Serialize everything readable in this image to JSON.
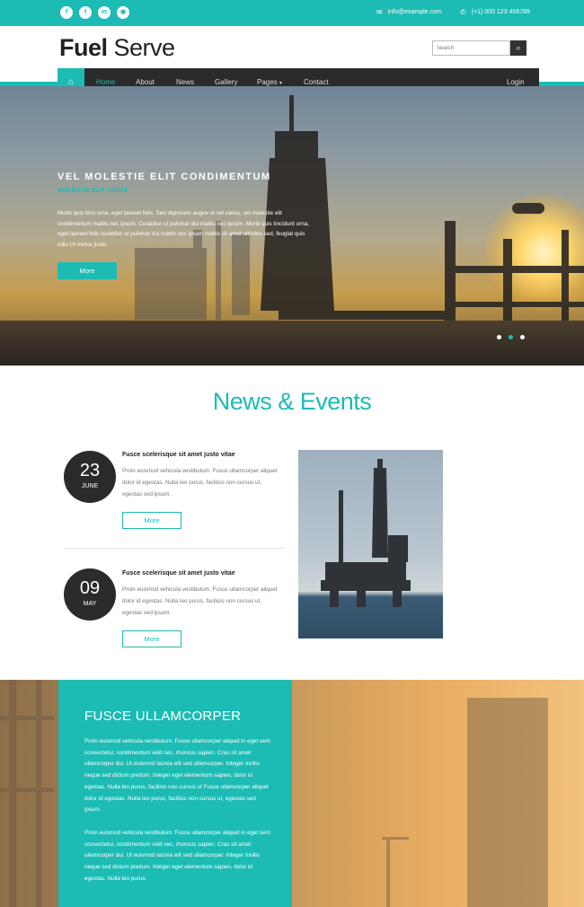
{
  "topbar": {
    "social_icons": [
      "facebook-icon",
      "twitter-icon",
      "linkedin-icon",
      "rss-icon"
    ],
    "email": "info@example.com",
    "phone": "(+1) 000 123 456789"
  },
  "header": {
    "logo_bold": "Fuel",
    "logo_light": "Serve",
    "search_placeholder": "Search"
  },
  "nav": {
    "items": [
      "Home",
      "About",
      "News",
      "Gallery",
      "Pages",
      "Contact"
    ],
    "login": "Login"
  },
  "hero": {
    "title": "VEL MOLESTIE ELIT CONDIMENTUM",
    "subtitle": "MOLESTIE ELIT CONDI",
    "text": "Morbi quis tinci urna, eget laoreet felis. Sed dignissim augue ut vel varius, vel molestie elit condimentum mattis nec ipsum. Curabitur ut pulvinar dui mattis nec ipsum. Morbi quis tincidunt urna, eget laoreet felis curabitur ut pulvinar dui mattis nec ipsum mattis sit amet ultricies sed, feugiat quis odio Ut metus justo.",
    "button": "More"
  },
  "news": {
    "title": "News & Events",
    "items": [
      {
        "day": "23",
        "month": "JUNE",
        "heading": "Fusce scelerisque sit amet justo vitae",
        "body": "Proin euismod vehicula vestibulum. Fusce ullamcorper aliquet dolor id egestas. Nulla leo purus, facilisis non cursus ut, egestas sed ipsum.",
        "button": "More"
      },
      {
        "day": "09",
        "month": "MAY",
        "heading": "Fusce scelerisque sit amet justo vitae",
        "body": "Proin euismod vehicula vestibulum. Fusce ullamcorper aliquet dolor id egestas. Nulla leo purus, facilisis non cursus ut, egestas sed ipsum.",
        "button": "More"
      }
    ]
  },
  "feature": {
    "title": "FUSCE ULLAMCORPER",
    "para1": "Proin euismod vehicula vestibulum. Fusce ullamcorper aliquet in eget sem consectetur, condimentum velit nec, rhoncus sapien. Cras sit amet ullamcorper dui. Ut euismod lacinia elit sed ullamcorper. Integer mollis neque sed dictum pretium. Integer eget elementum sapien, dolor id egestas. Nulla leo purus, facilisis non cursus ut Fusce ullamcorper aliquet dolor id egestas. Nulla leo purus, facilisis non cursus ut, egestas sed ipsum.",
    "para2": "Proin euismod vehicula vestibulum. Fusce ullamcorper aliquet in eget sem consectetur, condimentum velit nec, rhoncus sapien. Cras sit amet ullamcorper dui. Ut euismod lacinia elit sed ullamcorper. Integer mollis neque sed dictum pretium. Integer eget elementum sapien, dolor id egestas. Nulla leo purus."
  },
  "colors": {
    "accent": "#1cbbb4",
    "dark": "#2b2b2b"
  }
}
